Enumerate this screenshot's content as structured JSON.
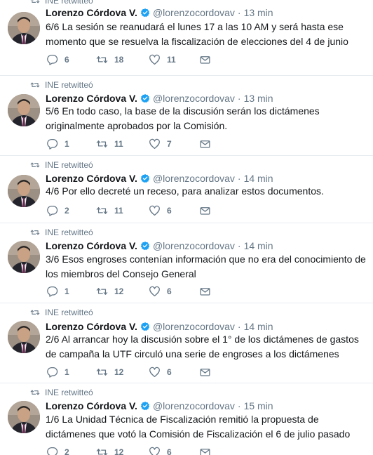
{
  "retweet_label": "INE retwitteó",
  "author": {
    "name": "Lorenzo Córdova V.",
    "handle": "@lorenzocordovav"
  },
  "tweets": [
    {
      "time": "13 min",
      "text": "6/6 La sesión se reanudará el lunes 17 a las 10 AM y será hasta ese momento que se resuelva la fiscalización de elecciones del 4 de junio",
      "replies": "6",
      "retweets": "18",
      "likes": "11"
    },
    {
      "time": "13 min",
      "text": "5/6 En todo caso, la base de la discusión serán los dictámenes originalmente aprobados por la Comisión.",
      "replies": "1",
      "retweets": "11",
      "likes": "7"
    },
    {
      "time": "14 min",
      "text": "4/6 Por ello decreté un receso, para analizar estos documentos.",
      "replies": "2",
      "retweets": "11",
      "likes": "6"
    },
    {
      "time": "14 min",
      "text": "3/6 Esos engroses contenían información que no era del conocimiento de los miembros del Consejo General",
      "replies": "1",
      "retweets": "12",
      "likes": "6"
    },
    {
      "time": "14 min",
      "text": "2/6 Al arrancar hoy la discusión sobre el 1° de los dictámenes de gastos de campaña la UTF circuló una serie de engroses a los dictámenes",
      "replies": "1",
      "retweets": "12",
      "likes": "6"
    },
    {
      "time": "15 min",
      "text": "1/6 La Unidad Técnica de Fiscalización remitió la propuesta de dictámenes que votó la Comisión de Fiscalización el 6 de julio pasado",
      "replies": "2",
      "retweets": "12",
      "likes": "6"
    }
  ],
  "colors": {
    "muted": "#657786",
    "text": "#14171a",
    "verified": "#1da1f2",
    "divider": "#e6ecf0"
  }
}
